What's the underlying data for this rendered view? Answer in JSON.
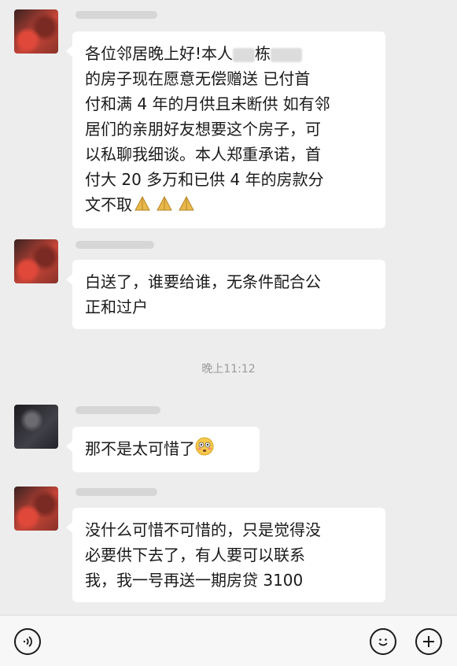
{
  "messages": [
    {
      "lines": [
        "各位邻居晚上好!本人",
        "栋",
        "的房子现在愿意无偿赠送 已付首",
        "付和满 4 年的月供且未断供 如有邻",
        "居们的亲朋好友想要这个房子，可",
        "以私聊我细谈。本人郑重承诺，首",
        "付大 20 多万和已供 4 年的房款分",
        "文不取"
      ],
      "reaction_icon": "folded-hands-icon"
    },
    {
      "lines": [
        "白送了，谁要给谁，无条件配合公",
        "正和过户"
      ]
    },
    {
      "lines": [
        "那不是太可惜了"
      ],
      "reaction_icon": "flushed-face-icon"
    },
    {
      "lines": [
        "没什么可惜不可惜的，只是觉得没",
        "必要供下去了，有人要可以联系",
        "我，我一号再送一期房贷 3100"
      ]
    }
  ],
  "timestamp": "晚上11:12",
  "bottom_bar": {
    "voice_icon": "voice-icon",
    "emoji_icon": "emoji-icon",
    "add_icon": "plus-icon"
  }
}
